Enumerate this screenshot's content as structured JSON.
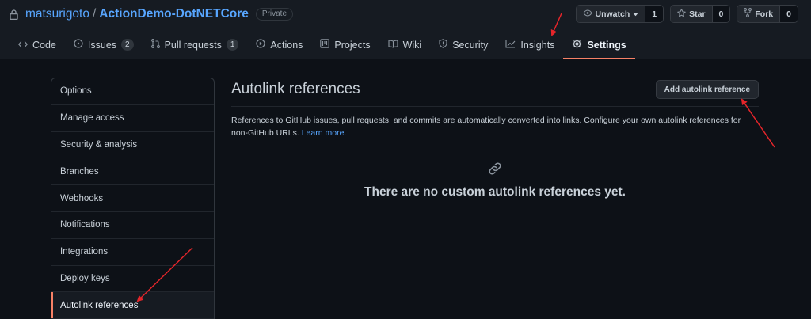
{
  "repo": {
    "owner": "matsurigoto",
    "separator": "/",
    "name": "ActionDemo-DotNETCore",
    "visibility": "Private",
    "icon": "lock-icon"
  },
  "actions": [
    {
      "label": "Unwatch",
      "icon": "eye-icon",
      "count": "1",
      "has_dropdown": true
    },
    {
      "label": "Star",
      "icon": "star-icon",
      "count": "0"
    },
    {
      "label": "Fork",
      "icon": "fork-icon",
      "count": "0"
    }
  ],
  "tabs": [
    {
      "label": "Code",
      "icon": "code-icon"
    },
    {
      "label": "Issues",
      "icon": "issue-icon",
      "counter": "2"
    },
    {
      "label": "Pull requests",
      "icon": "pull-request-icon",
      "counter": "1"
    },
    {
      "label": "Actions",
      "icon": "play-icon"
    },
    {
      "label": "Projects",
      "icon": "project-icon"
    },
    {
      "label": "Wiki",
      "icon": "book-icon"
    },
    {
      "label": "Security",
      "icon": "shield-icon"
    },
    {
      "label": "Insights",
      "icon": "graph-icon"
    },
    {
      "label": "Settings",
      "icon": "gear-icon",
      "selected": true
    }
  ],
  "sidebar": {
    "items": [
      {
        "label": "Options"
      },
      {
        "label": "Manage access"
      },
      {
        "label": "Security & analysis"
      },
      {
        "label": "Branches"
      },
      {
        "label": "Webhooks"
      },
      {
        "label": "Notifications"
      },
      {
        "label": "Integrations"
      },
      {
        "label": "Deploy keys"
      },
      {
        "label": "Autolink references",
        "active": true
      }
    ]
  },
  "main": {
    "title": "Autolink references",
    "add_button": "Add autolink reference",
    "description": "References to GitHub issues, pull requests, and commits are automatically converted into links. Configure your own autolink references for non-GitHub URLs.",
    "learn_more": "Learn more.",
    "empty_message": "There are no custom autolink references yet.",
    "empty_icon": "link-icon"
  },
  "colors": {
    "background": "#0d1117",
    "header": "#161b22",
    "accent": "#f78166",
    "link": "#58a6ff",
    "annotation_arrow": "#e5252a"
  }
}
